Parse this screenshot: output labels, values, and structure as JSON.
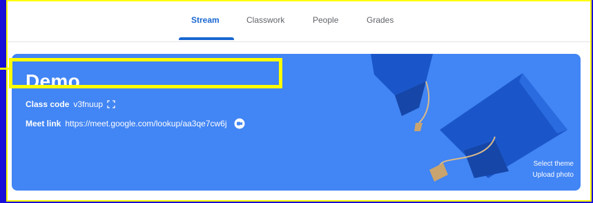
{
  "tabs": [
    {
      "label": "Stream",
      "active": true
    },
    {
      "label": "Classwork",
      "active": false
    },
    {
      "label": "People",
      "active": false
    },
    {
      "label": "Grades",
      "active": false
    }
  ],
  "banner": {
    "title": "Demo",
    "class_code_label": "Class code",
    "class_code_value": "v3fnuup",
    "meet_link_label": "Meet link",
    "meet_link_value": "https://meet.google.com/lookup/aa3qe7cw6j",
    "select_theme": "Select theme",
    "upload_photo": "Upload photo"
  },
  "colors": {
    "banner": "#4285f4",
    "tab_active": "#1967d2",
    "highlight": "#ffff00",
    "page_border": "#1a0fd6"
  },
  "icons": [
    "expand-icon",
    "meet-icon",
    "graduation-cap-illustration"
  ]
}
